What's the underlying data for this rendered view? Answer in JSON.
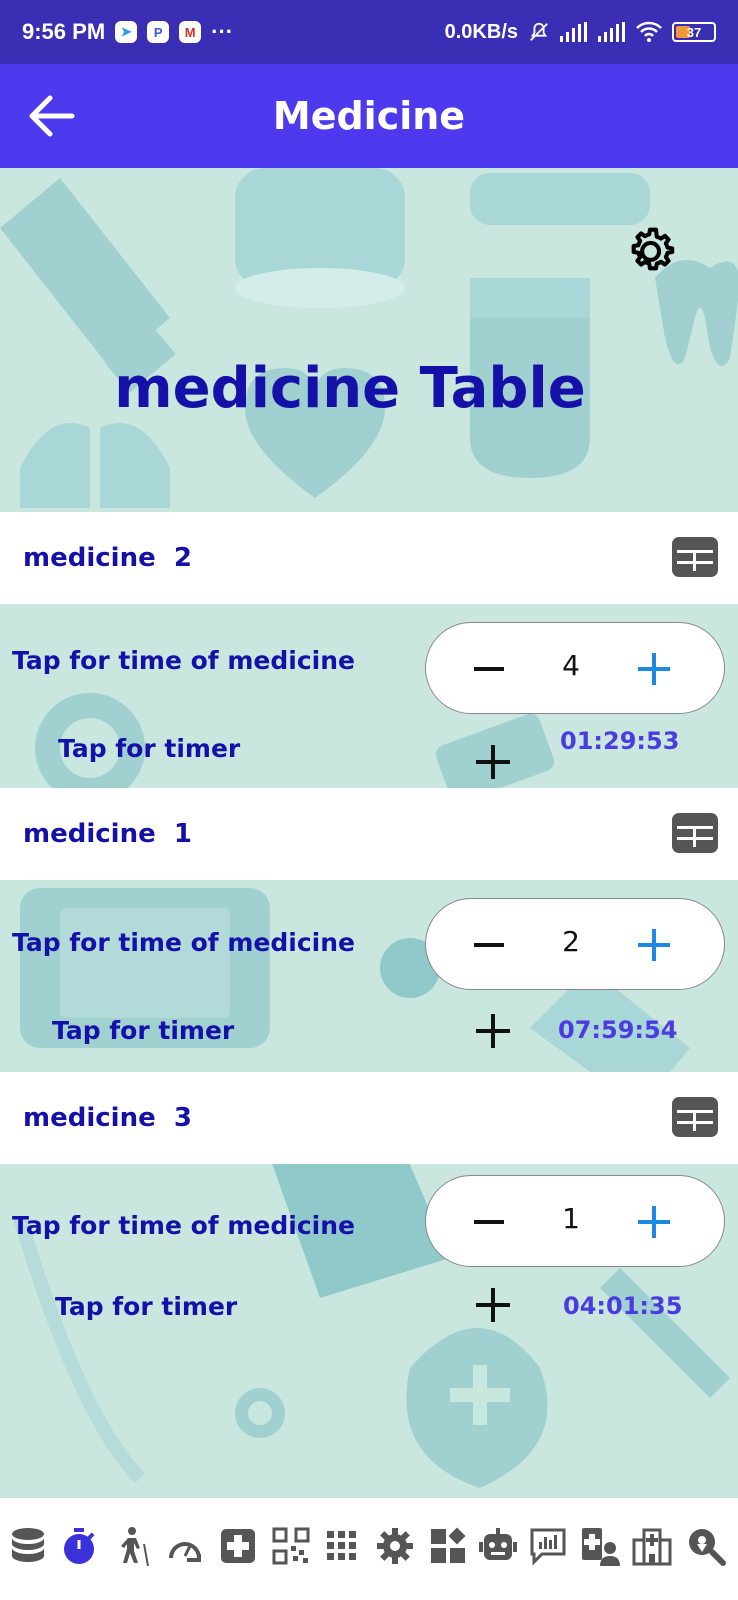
{
  "status_bar": {
    "time": "9:56 PM",
    "apps": [
      "telegram-icon",
      "p-app-icon",
      "gmail-icon"
    ],
    "more": "···",
    "speed": "0.0KB/s",
    "battery": "37"
  },
  "app_bar": {
    "title": "Medicine",
    "back_icon": "arrow-left-icon"
  },
  "hero": {
    "title": "medicine Table",
    "settings_icon": "gear-icon"
  },
  "medicines": [
    {
      "name": "medicine  2",
      "tap_time_label": "Tap for time of medicine",
      "count": "4",
      "tap_timer_label": "Tap for timer",
      "timer": "01:29:53"
    },
    {
      "name": "medicine  1",
      "tap_time_label": "Tap for time of medicine",
      "count": "2",
      "tap_timer_label": "Tap for timer",
      "timer": "07:59:54"
    },
    {
      "name": "medicine  3",
      "tap_time_label": "Tap for time of medicine",
      "count": "1",
      "tap_timer_label": "Tap for timer",
      "timer": "04:01:35"
    }
  ],
  "bottom_nav": [
    "database-icon",
    "stopwatch-icon",
    "walking-icon",
    "gauge-icon",
    "medical-plus-icon",
    "qr-code-icon",
    "grid-icon",
    "gear-icon",
    "widgets-icon",
    "robot-icon",
    "chart-message-icon",
    "doctor-icon",
    "hospital-icon",
    "search-location-icon"
  ],
  "colors": {
    "app_bar": "#4d3aee",
    "status_bar": "#3a2fb4",
    "title": "#1410a8",
    "timer": "#4a3ce0",
    "background": "#c9e7df",
    "accent_plus": "#1e88e5",
    "active_nav": "#3b31d8"
  }
}
